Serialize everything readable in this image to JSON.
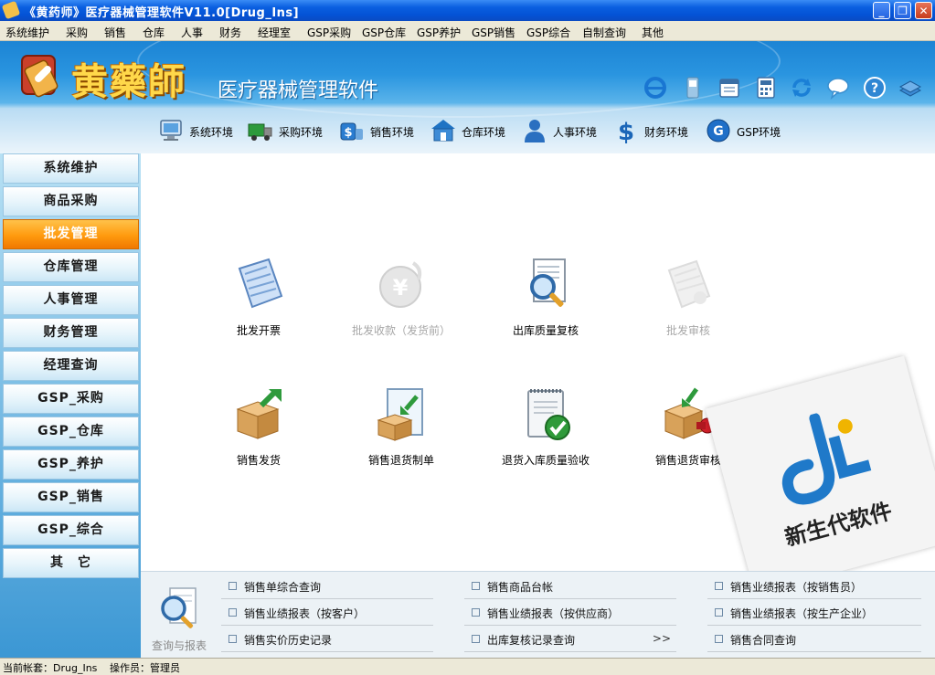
{
  "window": {
    "title": "《黄药师》医疗器械管理软件V11.0[Drug_Ins]",
    "controls": [
      "minimize-icon",
      "restore-icon",
      "close-icon"
    ]
  },
  "menubar": [
    "系统维护",
    "采购",
    "销售",
    "仓库",
    "人事",
    "财务",
    "经理室",
    "GSP采购",
    "GSP仓库",
    "GSP养护",
    "GSP销售",
    "GSP综合",
    "自制查询",
    "其他"
  ],
  "banner": {
    "logo_main": "黄藥師",
    "logo_sub": "医疗器械管理软件",
    "toolbar_icons": [
      "ie-icon",
      "phone-icon",
      "calendar-icon",
      "calculator-icon",
      "refresh-icon",
      "chat-icon",
      "help-icon",
      "books-icon"
    ]
  },
  "environments": [
    {
      "label": "系统环境",
      "icon": "monitor-icon"
    },
    {
      "label": "采购环境",
      "icon": "truck-icon"
    },
    {
      "label": "销售环境",
      "icon": "money-cup-icon"
    },
    {
      "label": "仓库环境",
      "icon": "warehouse-icon"
    },
    {
      "label": "人事环境",
      "icon": "person-icon"
    },
    {
      "label": "财务环境",
      "icon": "dollar-icon"
    },
    {
      "label": "GSP环境",
      "icon": "gsp-icon"
    }
  ],
  "sidebar": {
    "items": [
      "系统维护",
      "商品采购",
      "批发管理",
      "仓库管理",
      "人事管理",
      "财务管理",
      "经理查询",
      "GSP_采购",
      "GSP_仓库",
      "GSP_养护",
      "GSP_销售",
      "GSP_综合",
      "其　它"
    ],
    "active": "批发管理"
  },
  "functions": [
    {
      "label": "批发开票",
      "icon": "invoice-scroll-icon",
      "enabled": true
    },
    {
      "label": "批发收款（发货前）",
      "icon": "yen-coin-icon",
      "enabled": false
    },
    {
      "label": "出库质量复核",
      "icon": "magnifier-document-icon",
      "enabled": true
    },
    {
      "label": "批发审核",
      "icon": "audit-scroll-icon",
      "enabled": false
    },
    {
      "label": "销售发货",
      "icon": "box-ship-icon",
      "enabled": true
    },
    {
      "label": "销售退货制单",
      "icon": "return-document-icon",
      "enabled": true
    },
    {
      "label": "退货入库质量验收",
      "icon": "notepad-check-icon",
      "enabled": true
    },
    {
      "label": "销售退货审核",
      "icon": "return-stamp-icon",
      "enabled": true
    }
  ],
  "watermark": {
    "text": "新生代软件"
  },
  "query": {
    "label": "查询与报表",
    "links": [
      {
        "text": "销售单综合查询"
      },
      {
        "text": "销售商品台帐"
      },
      {
        "text": "销售业绩报表（按销售员）"
      },
      {
        "text": "销售业绩报表（按客户）"
      },
      {
        "text": "销售业绩报表（按供应商）"
      },
      {
        "text": "销售业绩报表（按生产企业）"
      },
      {
        "text": "销售实价历史记录"
      },
      {
        "text": "出库复核记录查询",
        "more": ">>"
      },
      {
        "text": "销售合同查询"
      }
    ]
  },
  "statusbar": {
    "account": "当前帐套：Drug_Ins",
    "operator": "操作员：管理员"
  }
}
